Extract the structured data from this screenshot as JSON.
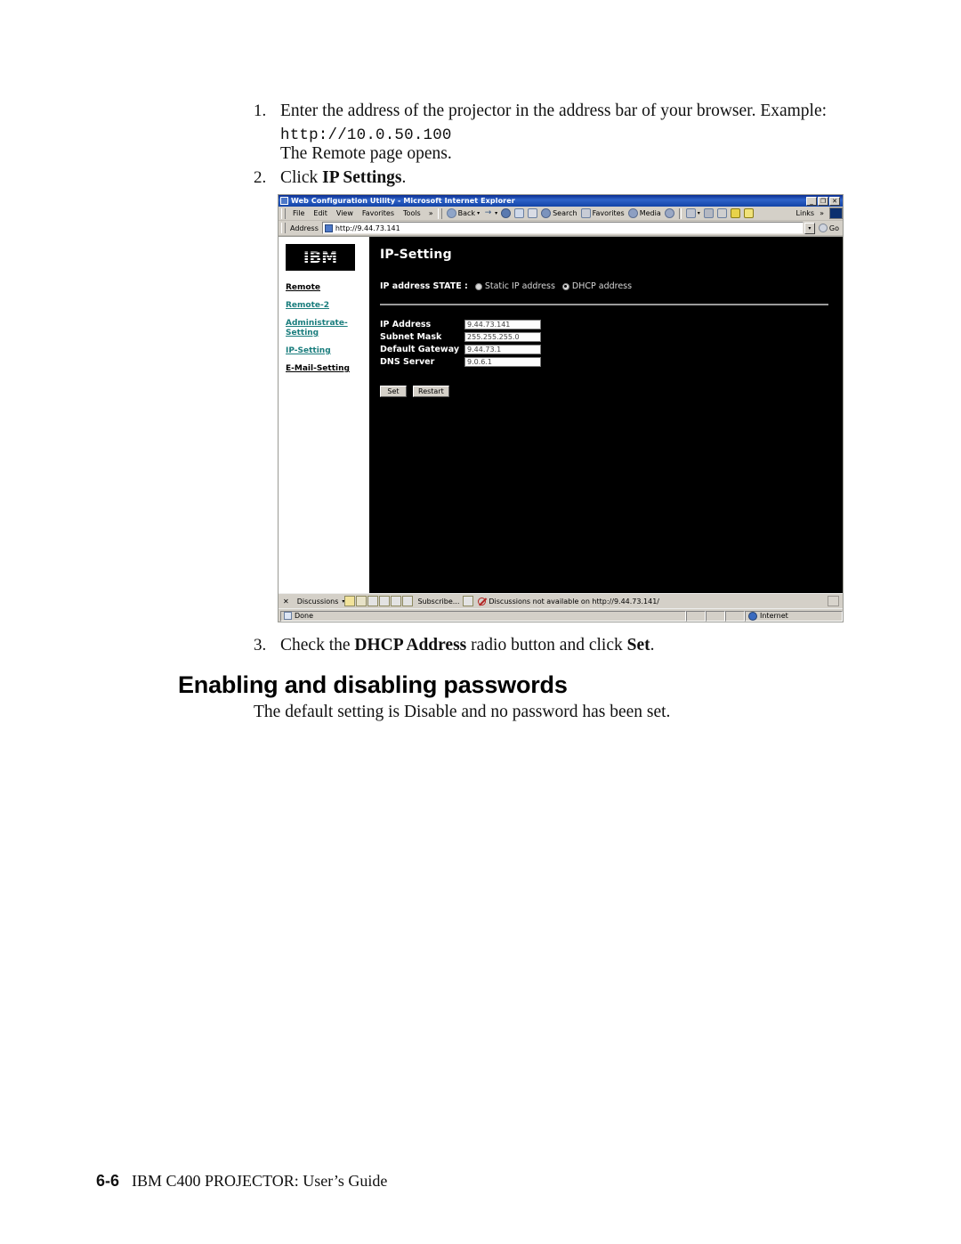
{
  "document": {
    "steps": [
      {
        "num": "1.",
        "text_before": "Enter the address of the projector in the address bar of your browser. Example:",
        "url": "http://10.0.50.100"
      },
      {
        "num": "2.",
        "text_before": "Click ",
        "bold": "IP Settings",
        "text_after": "."
      },
      {
        "num": "3.",
        "text_before": "Check the ",
        "bold": "DHCP Address",
        "text_mid": " radio button and click ",
        "bold2": "Set",
        "text_after": "."
      }
    ],
    "result_line": "The Remote page opens.",
    "section_title": "Enabling and disabling passwords",
    "section_body": "The default setting is Disable and no password has been set.",
    "footer_page": "6-6",
    "footer_text": "IBM C400 PROJECTOR: User’s Guide"
  },
  "browser": {
    "title": "Web Configuration Utility - Microsoft Internet Explorer",
    "window_buttons": [
      "_",
      "❐",
      "✕"
    ],
    "menus": [
      "File",
      "Edit",
      "View",
      "Favorites",
      "Tools"
    ],
    "menu_overflow": "»",
    "toolbar": [
      {
        "icon": "back-icon",
        "label": "Back"
      },
      {
        "icon": "forward-icon",
        "label": ""
      },
      {
        "icon": "stop-icon",
        "label": ""
      },
      {
        "icon": "refresh-icon",
        "label": ""
      },
      {
        "icon": "home-icon",
        "label": ""
      },
      {
        "icon": "search-icon",
        "label": "Search"
      },
      {
        "icon": "favorites-icon",
        "label": "Favorites"
      },
      {
        "icon": "media-icon",
        "label": "Media"
      },
      {
        "icon": "history-icon",
        "label": ""
      },
      {
        "icon": "mail-icon",
        "label": ""
      },
      {
        "icon": "print-icon",
        "label": ""
      },
      {
        "icon": "edit-icon",
        "label": ""
      },
      {
        "icon": "messenger-icon",
        "label": ""
      },
      {
        "icon": "msn-icon",
        "label": ""
      }
    ],
    "links_label": "Links",
    "links_overflow": "»",
    "address_label": "Address",
    "address_value": "http://9.44.73.141",
    "go_label": "Go"
  },
  "webpage": {
    "logo_text": "IBM",
    "nav": [
      {
        "label": "Remote",
        "style": "black"
      },
      {
        "label": "Remote-2",
        "style": "teal"
      },
      {
        "label": "Administrate-Setting",
        "style": "teal"
      },
      {
        "label": "IP-Setting",
        "style": "teal"
      },
      {
        "label": "E-Mail-Setting",
        "style": "black"
      }
    ],
    "page_title": "IP-Setting",
    "state_label": "IP address STATE :",
    "state_options": [
      {
        "label": "Static IP address",
        "selected": false
      },
      {
        "label": "DHCP address",
        "selected": true
      }
    ],
    "fields": [
      {
        "label": "IP Address",
        "value": "9.44.73.141"
      },
      {
        "label": "Subnet Mask",
        "value": "255.255.255.0"
      },
      {
        "label": "Default Gateway",
        "value": "9.44.73.1"
      },
      {
        "label": "DNS Server",
        "value": "9.0.6.1"
      }
    ],
    "buttons": [
      {
        "label": "Set"
      },
      {
        "label": "Restart"
      }
    ]
  },
  "discussions_bar": {
    "close": "✕",
    "menu_label": "Discussions",
    "menu_caret": "▾",
    "subscribe_label": "Subscribe...",
    "warning": "Discussions not available on http://9.44.73.141/"
  },
  "status_bar": {
    "main": "Done",
    "zone": "Internet"
  },
  "colors": {
    "titlebar_start": "#0a2d8f",
    "titlebar_end": "#1344a8",
    "chrome": "#d4d0c8",
    "page_background": "#000000",
    "link_teal": "#1a7d7d",
    "warning_red": "#b32222"
  }
}
